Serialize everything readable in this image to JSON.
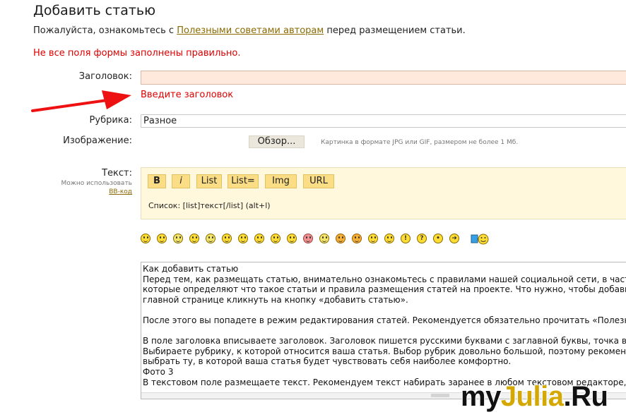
{
  "page": {
    "title": "Добавить статью",
    "notice_before": "Пожалуйста, ознакомьтесь с ",
    "notice_link": "Полезными советами авторам",
    "notice_after": " перед размещением статьи.",
    "form_error": "Не все поля формы заполнены правильно."
  },
  "form": {
    "title_label": "Заголовок:",
    "title_value": "",
    "title_error": "Введите заголовок",
    "category_label": "Рубрика:",
    "category_value": "Разное",
    "image_label": "Изображение:",
    "browse_label": "Обзор...",
    "image_hint": "Картинка в формате JPG или GIF, размером не более 1 Мб.",
    "text_label": "Текст:",
    "bb_hint": "Можно использовать",
    "bb_link": "BB-код"
  },
  "editor": {
    "buttons": [
      "B",
      "i",
      "List",
      "List=",
      "Img",
      "URL"
    ],
    "hint": "Список: [list]текст[/list] (alt+l)"
  },
  "smileys": [
    "smile-icon",
    "grin-icon",
    "sad-icon",
    "shocked-icon",
    "dizzy-icon",
    "neutral-icon",
    "cool-icon",
    "laugh-icon",
    "confused-icon",
    "tongue-icon",
    "angry-red-icon",
    "unhappy-icon",
    "evil-icon",
    "twisted-icon",
    "rolleyes-icon",
    "wink-icon",
    "exclaim-icon",
    "question-icon",
    "idea-icon",
    "arrow-icon",
    "special-smiley-icon"
  ],
  "text": {
    "lines": [
      "Как добавить статью",
      "Перед тем, как размещать статью, внимательно ознакомьтесь с правилами нашей социальной сети, в частн",
      "которые определяют что такое статьи и правила размещения статей на проекте. Что нужно, чтобы добавит",
      "главной странице кликнуть на кнопку «добавить статью».",
      "",
      "После этого вы попадете в режим редактирования статей. Рекомендуется обязательно прочитать «Полезн",
      "",
      "В поле заголовка вписываете заголовок. Заголовок пишется русскими буквами с заглавной буквы, точка в",
      "Выбираете рубрику, к которой относится ваша статья. Выбор рубрик довольно большой, поэтому рекоменд",
      "выбрать ту, в которой ваша статья будет чувствовать себя наиболее комфортно.",
      "Фото 3",
      "В текстовом поле размещаете текст. Рекомендуем текст набирать заранее в любом текстовом редакторе, ч"
    ]
  },
  "watermark": {
    "part1": "my",
    "part2": "Julia",
    "part3": ".Ru"
  },
  "colors": {
    "error": "#e00000",
    "link": "#8a6a00",
    "editor_bg": "#fff8dc",
    "bb_button": "#fbdd86",
    "title_input_bg": "#ffe9dc"
  }
}
